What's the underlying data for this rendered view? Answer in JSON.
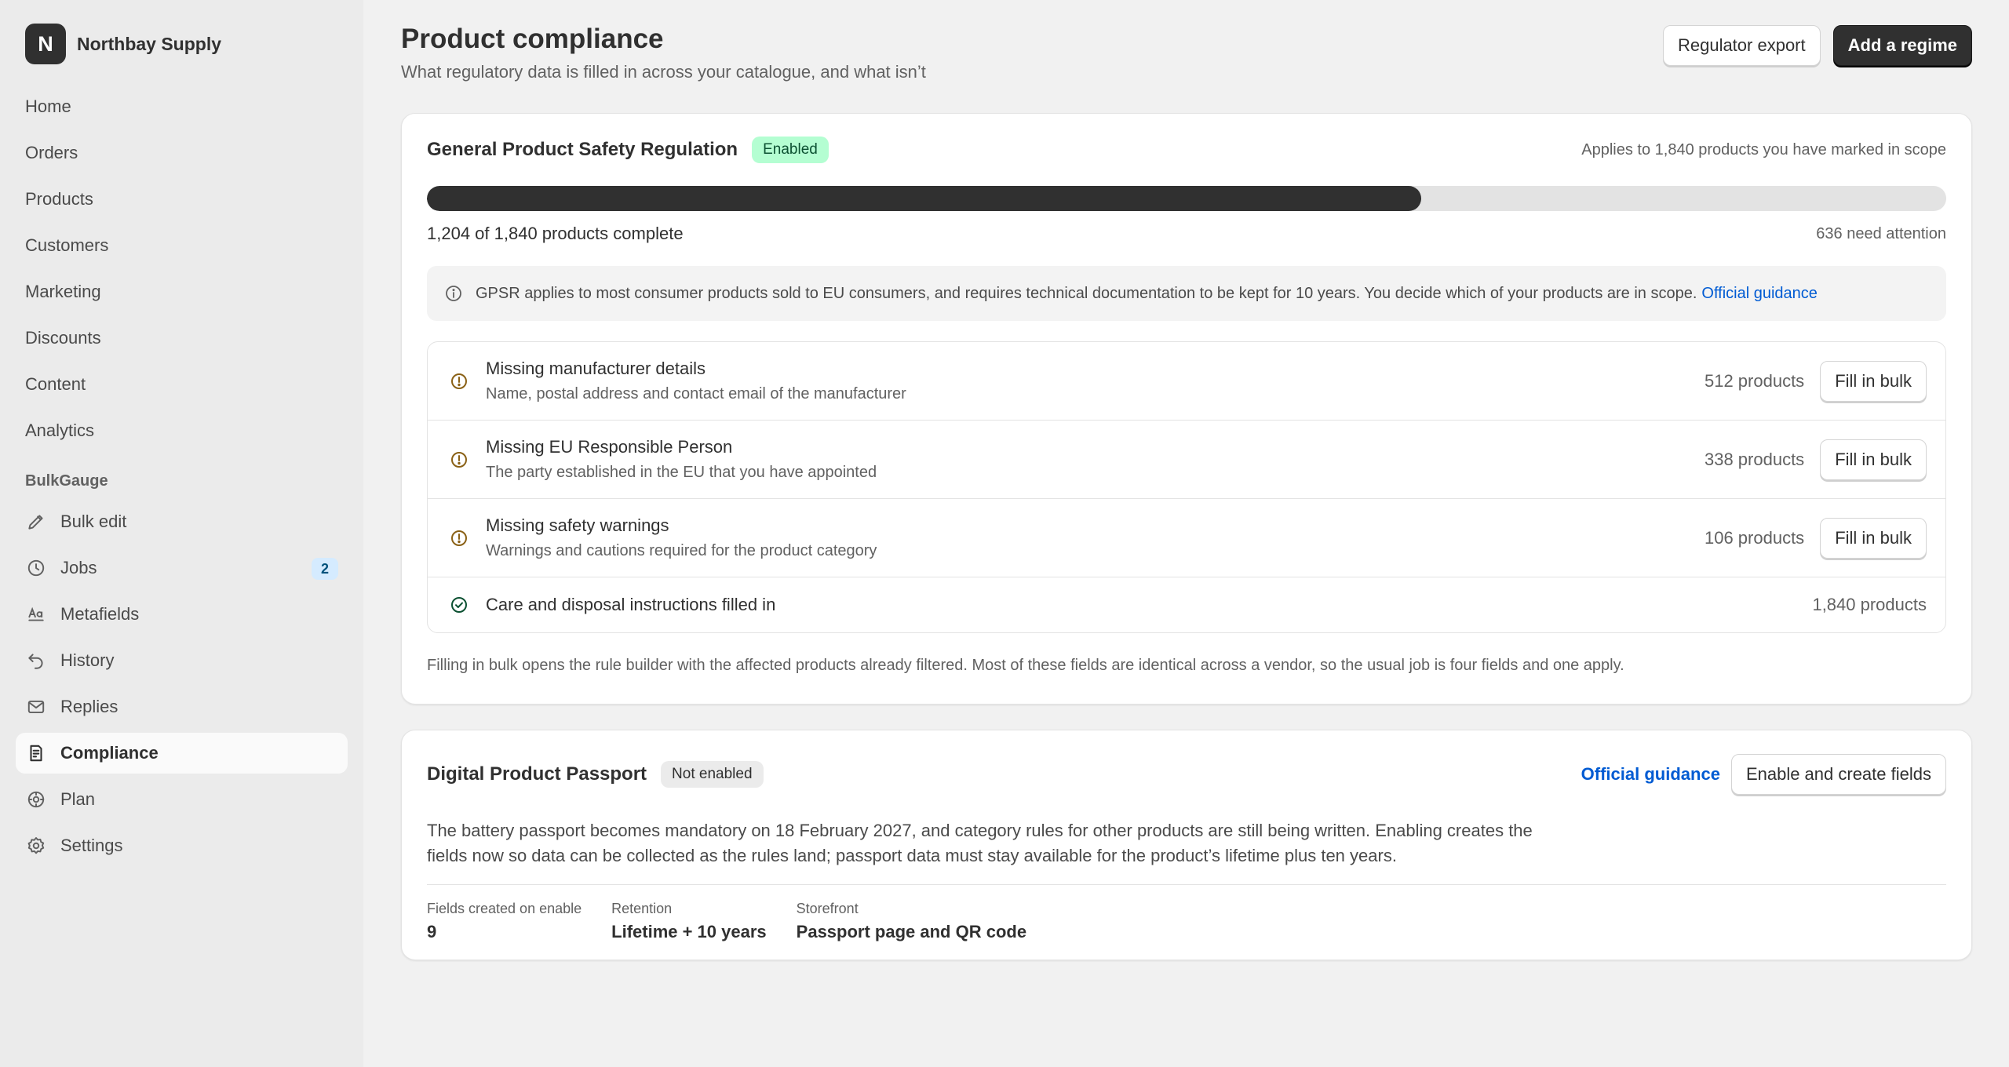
{
  "app": {
    "logo_letter": "N",
    "store_name": "Northbay Supply"
  },
  "sidebar": {
    "items": [
      {
        "label": "Home"
      },
      {
        "label": "Orders"
      },
      {
        "label": "Products"
      },
      {
        "label": "Customers"
      },
      {
        "label": "Marketing"
      },
      {
        "label": "Discounts"
      },
      {
        "label": "Content"
      },
      {
        "label": "Analytics"
      }
    ],
    "section_title": "BulkGauge",
    "app_items": [
      {
        "label": "Bulk edit",
        "icon": "pencil-icon"
      },
      {
        "label": "Jobs",
        "icon": "clock-icon",
        "badge": "2"
      },
      {
        "label": "Metafields",
        "icon": "metafields-icon"
      },
      {
        "label": "History",
        "icon": "undo-icon"
      },
      {
        "label": "Replies",
        "icon": "mail-icon"
      },
      {
        "label": "Compliance",
        "icon": "compliance-icon",
        "active": true
      },
      {
        "label": "Plan",
        "icon": "plan-icon"
      },
      {
        "label": "Settings",
        "icon": "gear-icon"
      }
    ]
  },
  "header": {
    "title": "Product compliance",
    "subtitle": "What regulatory data is filled in across your catalogue, and what isn’t",
    "export_label": "Regulator export",
    "add_label": "Add a regime"
  },
  "gpsr": {
    "title": "General Product Safety Regulation",
    "status": "Enabled",
    "scope_text": "Applies to 1,840 products you have marked in scope",
    "progress_fraction": 0.6543,
    "progress_text": "1,204 of 1,840 products complete",
    "attention_text": "636 need attention",
    "info_text": "GPSR applies to most consumer products sold to EU consumers, and requires technical documentation to be kept for 10 years. You decide which of your products are in scope.",
    "info_link": "Official guidance",
    "rows": [
      {
        "title": "Missing manufacturer details",
        "sub": "Name, postal address and contact email of the manufacturer",
        "count": "512 products",
        "action": "Fill in bulk"
      },
      {
        "title": "Missing EU Responsible Person",
        "sub": "The party established in the EU that you have appointed",
        "count": "338 products",
        "action": "Fill in bulk"
      },
      {
        "title": "Missing safety warnings",
        "sub": "Warnings and cautions required for the product category",
        "count": "106 products",
        "action": "Fill in bulk"
      }
    ],
    "done_row": {
      "title": "Care and disposal instructions filled in",
      "count": "1,840 products"
    },
    "footnote": "Filling in bulk opens the rule builder with the affected products already filtered. Most of these fields are identical across a vendor, so the usual job is four fields and one apply."
  },
  "dpp": {
    "title": "Digital Product Passport",
    "status": "Not enabled",
    "guidance_link": "Official guidance",
    "enable_label": "Enable and create fields",
    "body": "The battery passport becomes mandatory on 18 February 2027, and category rules for other products are still being written. Enabling creates the fields now so data can be collected as the rules land; passport data must stay available for the product’s lifetime plus ten years.",
    "stats": [
      {
        "label": "Fields created on enable",
        "value": "9"
      },
      {
        "label": "Retention",
        "value": "Lifetime + 10 years"
      },
      {
        "label": "Storefront",
        "value": "Passport page and QR code"
      }
    ]
  },
  "colors": {
    "accent": "#303030",
    "link": "#005bd3",
    "success_bg": "#b4fed2",
    "warning_icon": "#8a6116",
    "success_icon": "#0c5132"
  }
}
